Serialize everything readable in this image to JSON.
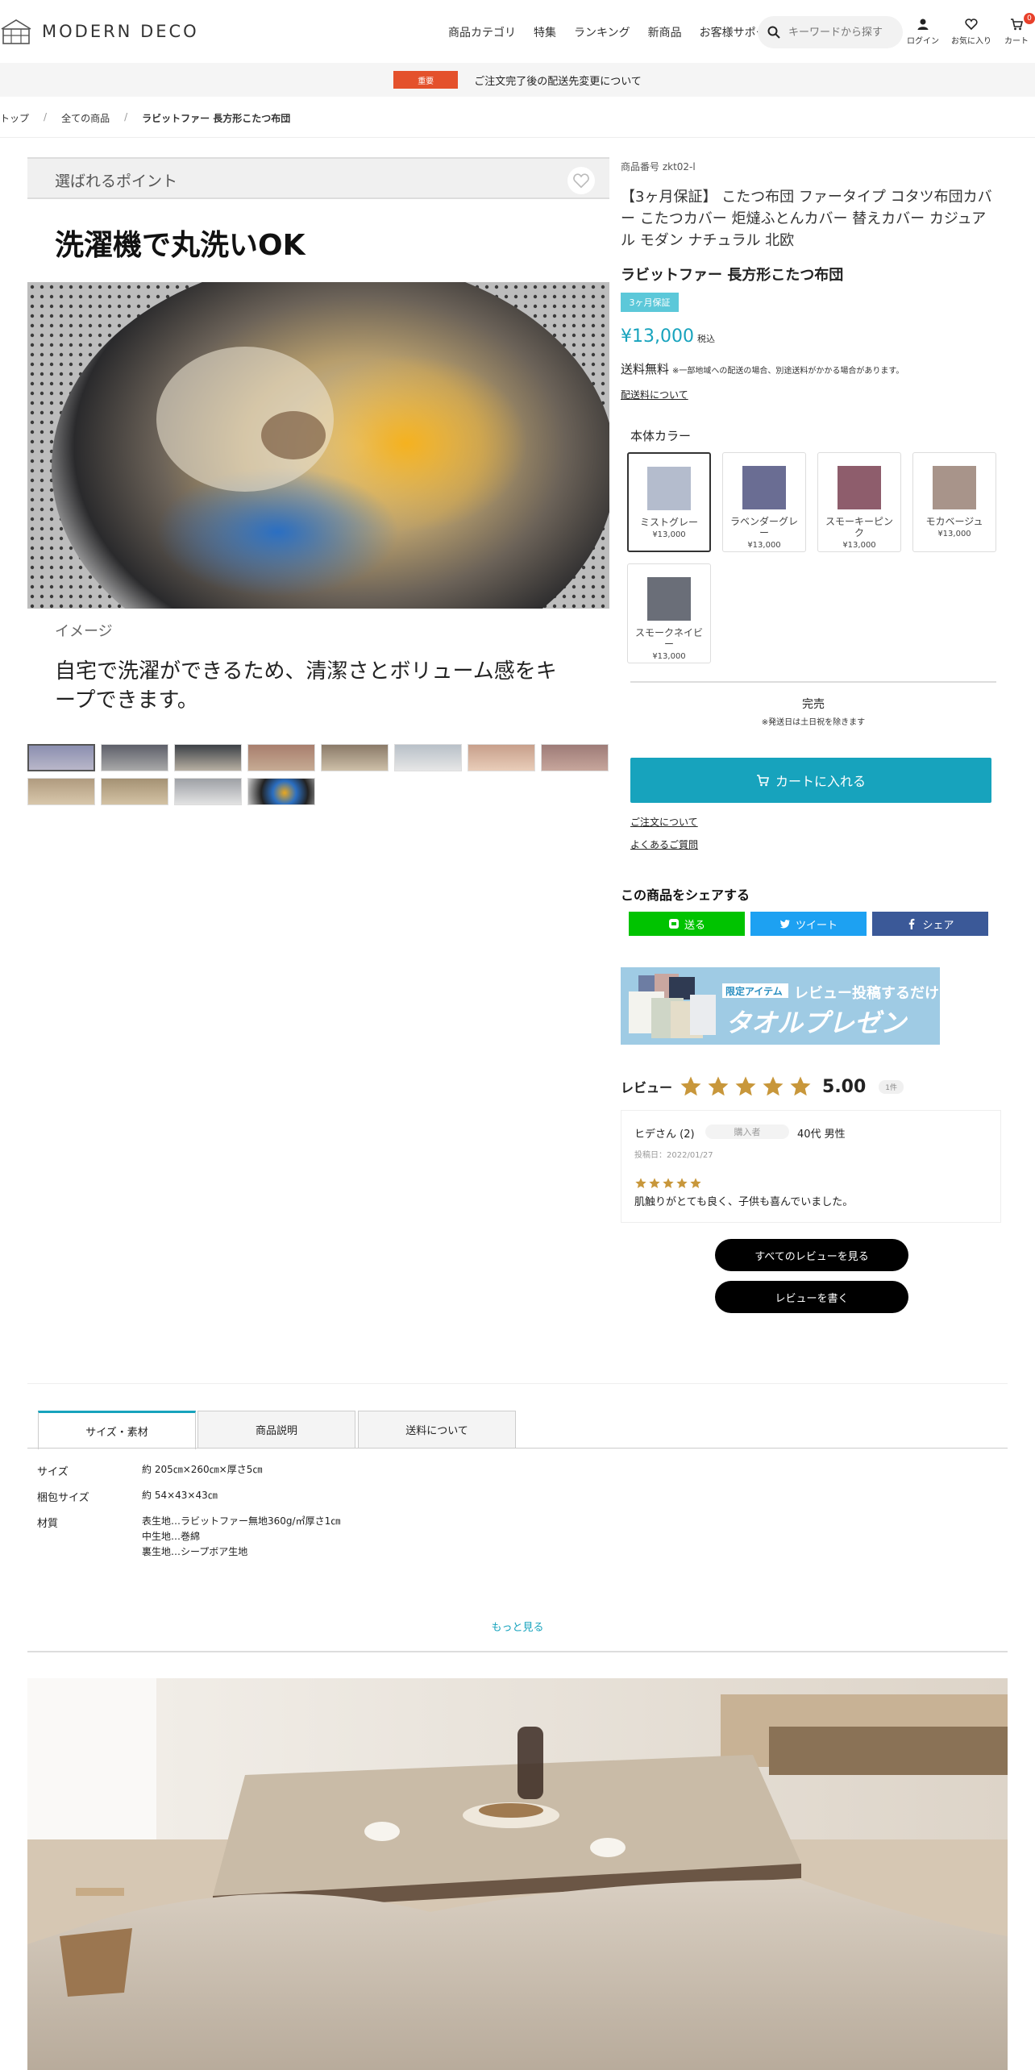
{
  "header": {
    "logo_text": "MODERN DECO",
    "nav": [
      "商品カテゴリ",
      "特集",
      "ランキング",
      "新商品",
      "お客様サポート"
    ],
    "search_placeholder": "キーワードから探す",
    "login_label": "ログイン",
    "favorites_label": "お気に入り",
    "cart_label": "カート",
    "cart_count": "0"
  },
  "notice": {
    "badge": "重要",
    "text": "ご注文完了後の配送先変更について"
  },
  "breadcrumb": [
    "トップ",
    "全ての商品",
    "ラビットファー 長方形こたつ布団"
  ],
  "gallery": {
    "point_label": "選ばれるポイント",
    "headline": "洗濯機で丸洗いOK",
    "caption": "イメージ",
    "subcopy": "自宅で洗濯ができるため、清潔さとボリューム感をキープできます。",
    "thumbnail_count": 12
  },
  "product": {
    "sku": "商品番号 zkt02-l",
    "title": "【3ヶ月保証】 こたつ布団 ファータイプ コタツ布団カバー こたつカバー 炬燵ふとんカバー 替えカバー カジュアル モダン ナチュラル 北欧",
    "name": "ラビットファー 長方形こたつ布団",
    "tag": "3ヶ月保証",
    "price": "¥13,000",
    "tax_note": "税込",
    "shipping": "送料無料",
    "shipping_note": "※一部地域への配送の場合、別途送料がかかる場合があります。",
    "shipping_link": "配送料について",
    "color_label": "本体カラー",
    "colors": [
      {
        "name": "ミストグレー",
        "price": "¥13,000",
        "color": "#b4bccd"
      },
      {
        "name": "ラベンダーグレー",
        "price": "¥13,000",
        "color": "#6a6d93"
      },
      {
        "name": "スモーキーピンク",
        "price": "¥13,000",
        "color": "#8e5d6c"
      },
      {
        "name": "モカベージュ",
        "price": "¥13,000",
        "color": "#a8948a"
      },
      {
        "name": "スモークネイビー",
        "price": "¥13,000",
        "color": "#6a6e78"
      }
    ],
    "stock_status": "完売",
    "stock_note": "※発送日は土日祝を除きます",
    "cart_button": "カートに入れる",
    "order_link": "ご注文について",
    "faq_link": "よくあるご質問"
  },
  "share": {
    "title": "この商品をシェアする",
    "line": "送る",
    "twitter": "ツイート",
    "facebook": "シェア"
  },
  "banner": {
    "badge": "限定アイテム",
    "line1": "レビュー投稿するだけ",
    "line2": "タオルプレゼント!"
  },
  "reviews": {
    "label": "レビュー",
    "rating": 5,
    "score": "5.00",
    "count": "1件",
    "item": {
      "author": "ヒデさん (2)",
      "buyer_tag": "購入者",
      "age": "40代 男性",
      "date": "投稿日：2022/01/27",
      "rating": 5,
      "text": "肌触りがとても良く、子供も喜んでいました。"
    },
    "all_button": "すべてのレビューを見る",
    "write_button": "レビューを書く"
  },
  "tabs": [
    "サイズ・素材",
    "商品説明",
    "送料について"
  ],
  "specs": [
    {
      "key": "サイズ",
      "value": [
        "約 205㎝×260㎝×厚さ5㎝"
      ]
    },
    {
      "key": "梱包サイズ",
      "value": [
        "約 54×43×43㎝"
      ]
    },
    {
      "key": "材質",
      "value": [
        "表生地…ラビットファー無地360g/㎡厚さ1㎝",
        "中生地…巻綿",
        "裏生地…シープボア生地"
      ]
    }
  ],
  "more_label": "もっと見る",
  "colors": {
    "accent": "#17a3bd",
    "notice": "#e4512c",
    "star": "#c8973b"
  }
}
